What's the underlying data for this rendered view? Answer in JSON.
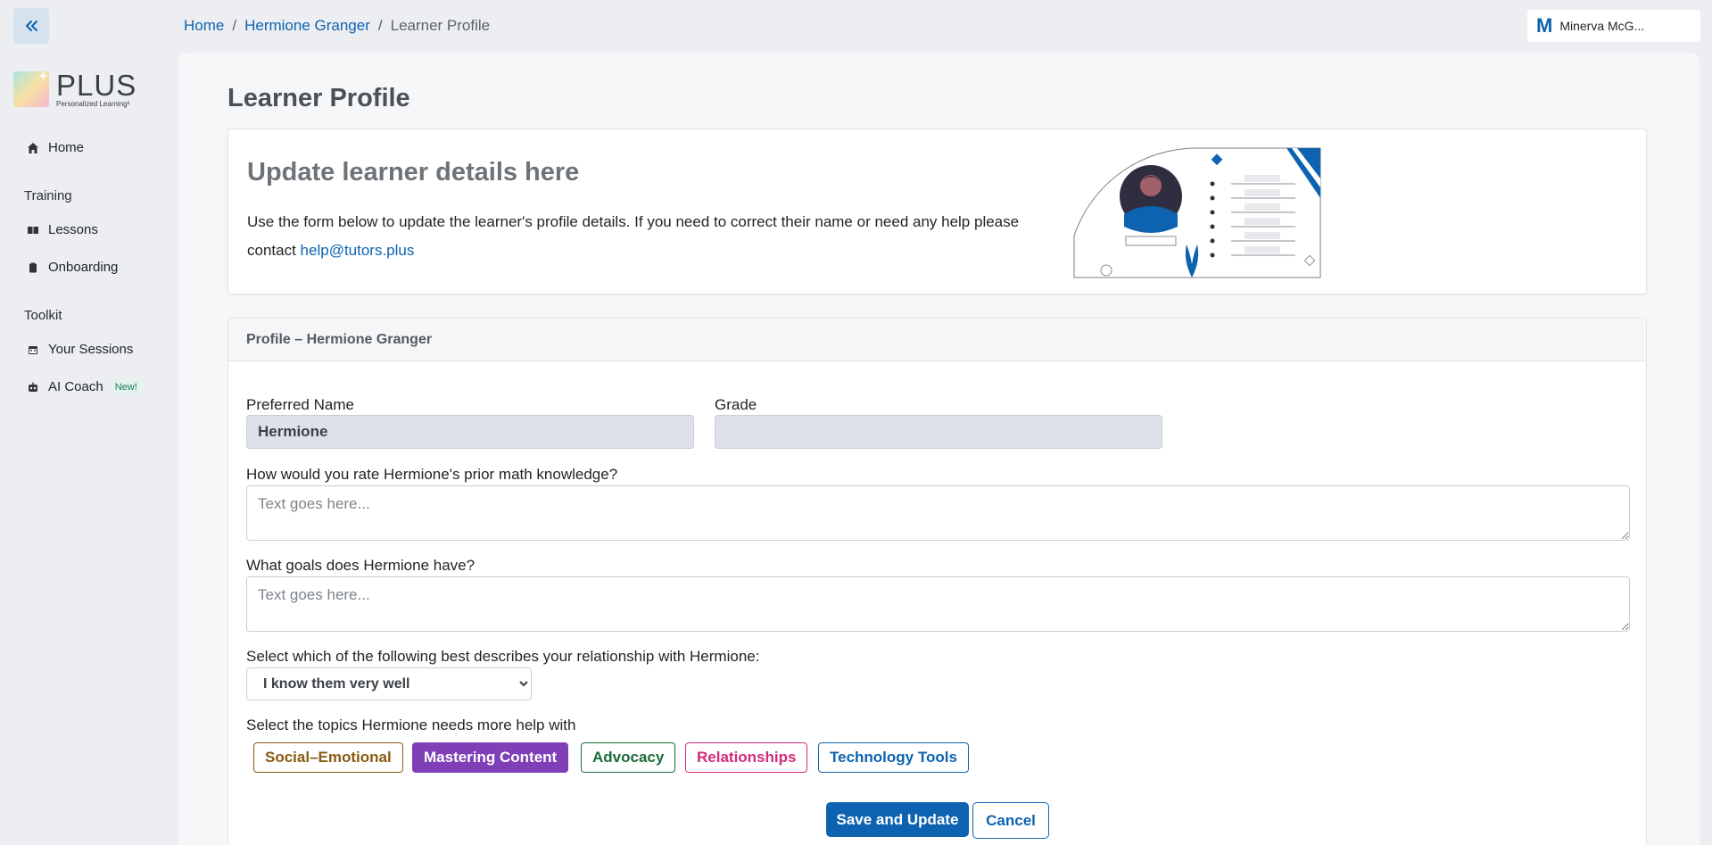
{
  "breadcrumb": {
    "home": "Home",
    "learner": "Hermione Granger",
    "current": "Learner Profile",
    "separator": "/"
  },
  "user": {
    "initial": "M",
    "name": "Minerva McG..."
  },
  "logo": {
    "name": "PLUS",
    "tagline": "Personalized Learning²",
    "plus_sign": "+"
  },
  "sidebar": {
    "home": "Home",
    "section_training": "Training",
    "lessons": "Lessons",
    "onboarding": "Onboarding",
    "section_toolkit": "Toolkit",
    "sessions": "Your Sessions",
    "ai_coach": "AI Coach",
    "ai_coach_badge": "New!"
  },
  "page": {
    "title": "Learner Profile"
  },
  "intro": {
    "heading": "Update learner details here",
    "body": "Use the form below to update the learner's profile details. If you need to correct their name or need any help please contact ",
    "email": "help@tutors.plus"
  },
  "form": {
    "header": "Profile – Hermione Granger",
    "preferred_name_label": "Preferred Name",
    "preferred_name_value": "Hermione",
    "grade_label": "Grade",
    "grade_value": "",
    "math_question": "How would you rate Hermione's prior math knowledge?",
    "goals_question": "What goals does Hermione have?",
    "textarea_placeholder": "Text goes here...",
    "relationship_question": "Select which of the following best describes your relationship with Hermione:",
    "relationship_selected": "I know them very well",
    "topics_question": "Select the topics Hermione needs more help with",
    "topics": [
      {
        "label": "Social–Emotional",
        "color": "#8a5a12",
        "selected": false
      },
      {
        "label": "Mastering Content",
        "color": "#7f3fb6",
        "selected": true
      },
      {
        "label": "Advocacy",
        "color": "#1b6b3a",
        "selected": false
      },
      {
        "label": "Relationships",
        "color": "#d12c7a",
        "selected": false
      },
      {
        "label": "Technology Tools",
        "color": "#0d63b0",
        "selected": false
      }
    ],
    "save_label": "Save and Update",
    "cancel_label": "Cancel"
  },
  "colors": {
    "primary": "#0d63b0",
    "background": "#eceef1"
  }
}
